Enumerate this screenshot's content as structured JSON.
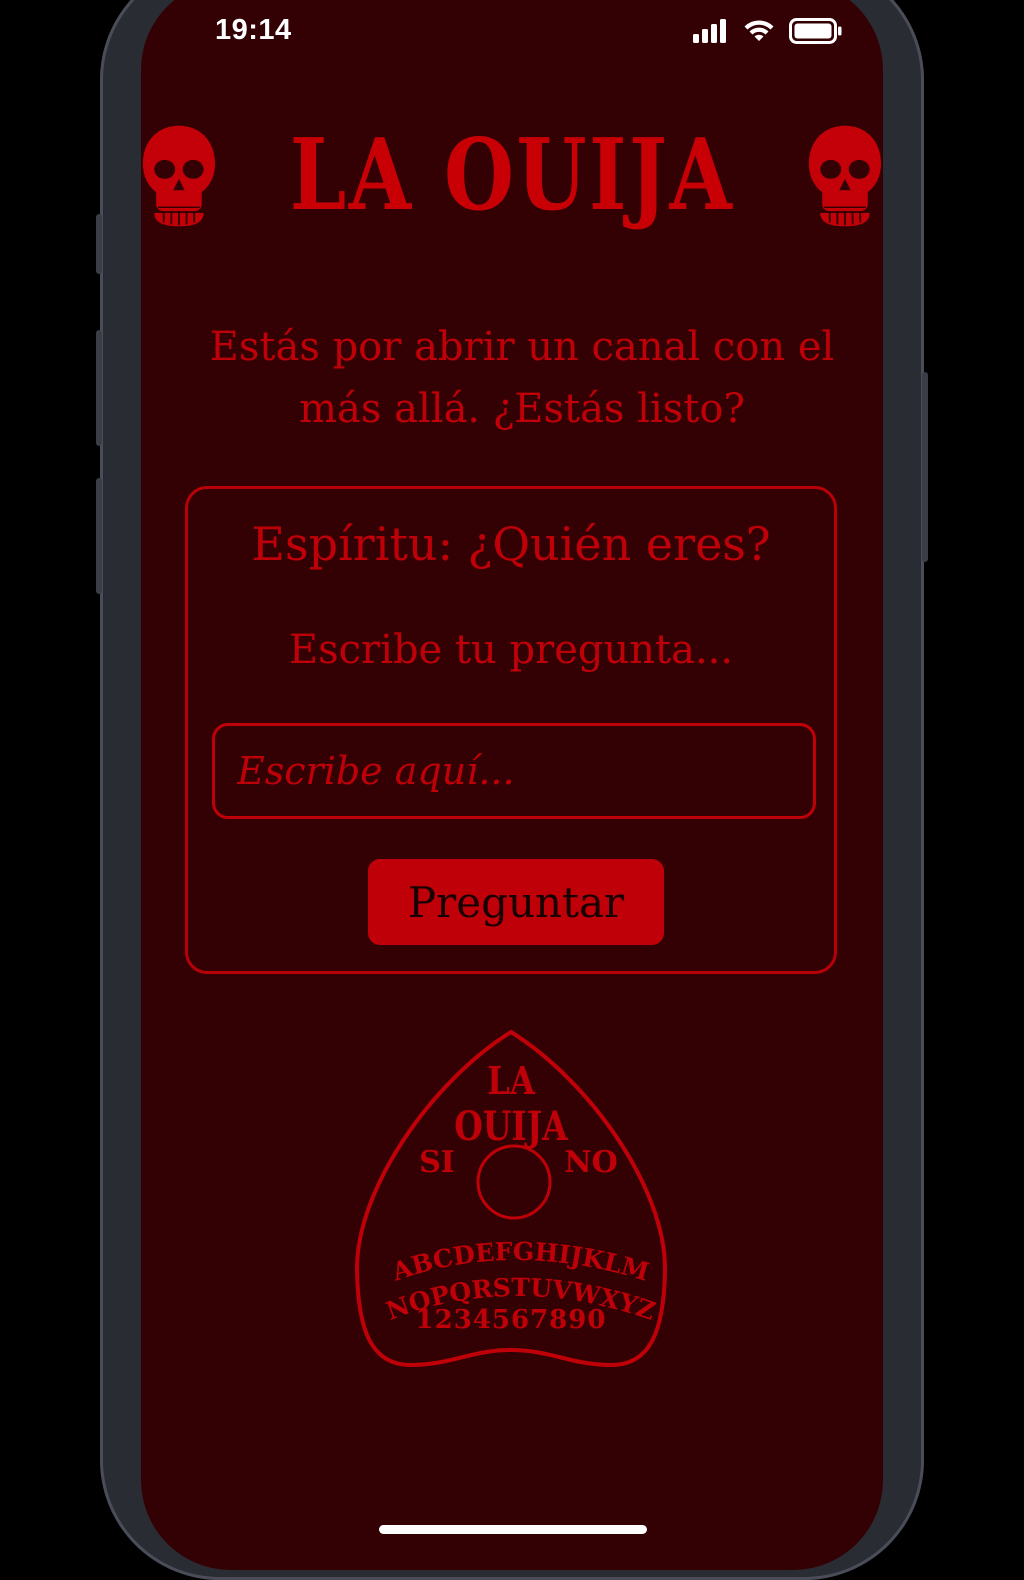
{
  "status_bar": {
    "time": "19:14"
  },
  "header": {
    "title": "LA OUIJA"
  },
  "intro_text": "Estás por abrir un canal con el más allá. ¿Estás listo?",
  "card": {
    "title": "Espíritu: ¿Quién eres?",
    "subtitle": "Escribe tu pregunta...",
    "input": {
      "placeholder": "Escribe aquí...",
      "value": ""
    },
    "button_label": "Preguntar"
  },
  "planchette": {
    "title_line1": "LA",
    "title_line2": "OUIJA",
    "yes_label": "SI",
    "no_label": "NO",
    "letters_row1": "ABCDEFGHIJKLM",
    "letters_row2": "NOPQRSTUVWXYZ",
    "numbers_row": "1234567890"
  },
  "colors": {
    "background": "#330003",
    "accent": "#c00008",
    "button_text": "#180000"
  },
  "icons": [
    "skull-icon",
    "signal-icon",
    "wifi-icon",
    "battery-icon"
  ]
}
